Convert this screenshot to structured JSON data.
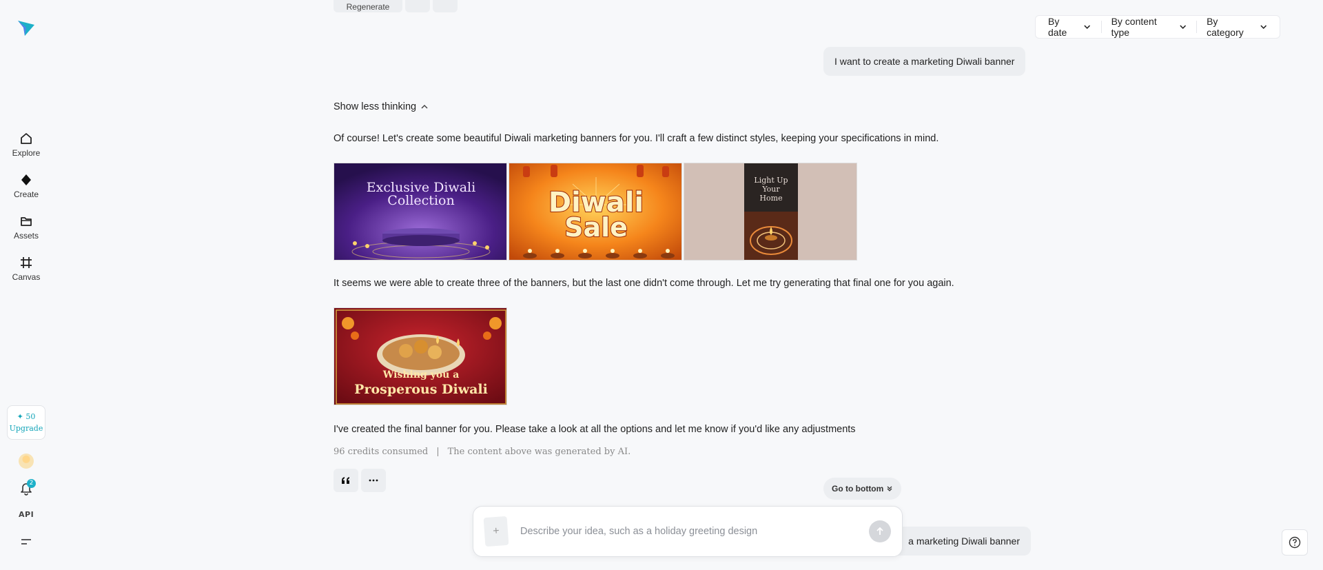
{
  "sidebar": {
    "logo_icon": "paper-plane-logo",
    "items": [
      {
        "label": "Explore",
        "icon": "home-icon"
      },
      {
        "label": "Create",
        "icon": "diamond-icon"
      },
      {
        "label": "Assets",
        "icon": "folder-icon"
      },
      {
        "label": "Canvas",
        "icon": "crop-icon"
      }
    ],
    "credits": "50",
    "upgrade_label": "Upgrade",
    "notification_count": "2",
    "api_label": "API"
  },
  "filters": {
    "by_date": "By date",
    "by_content_type": "By content type",
    "by_category": "By category"
  },
  "top_toolbar": {
    "regenerate_label": "Regenerate"
  },
  "chat": {
    "user_message_1": "I want to create a marketing Diwali banner",
    "thinking_toggle": "Show less thinking",
    "ai_intro": "Of course! Let's create some beautiful Diwali marketing banners for you. I'll craft a few distinct styles, keeping your specifications in mind.",
    "banners": [
      {
        "title_line1": "Exclusive Diwali",
        "title_line2": "Collection"
      },
      {
        "title_line1": "Diwali",
        "title_line2": "Sale"
      },
      {
        "title_line1": "Light Up",
        "title_line2": "Your",
        "title_line3": "Home"
      }
    ],
    "ai_followup": "It seems we were able to create three of the banners, but the last one didn't come through. Let me try generating that final one for you again.",
    "banner_final": {
      "title_line1": "Wishing you a",
      "title_line2": "Prosperous Diwali"
    },
    "ai_final": "I've created the final banner for you. Please take a look at all the options and let me know if you'd like any adjustments",
    "credits_consumed": "96 credits consumed",
    "separator": "|",
    "ai_disclaimer": "The content above was generated by AI.",
    "go_to_bottom": "Go to bottom",
    "user_message_2_partial": "a marketing Diwali banner"
  },
  "input": {
    "placeholder": "Describe your idea, such as a holiday greeting design",
    "attach_glyph": "+"
  },
  "colors": {
    "accent": "#1db0c8",
    "background": "#f7f8fa",
    "bubble": "#eceef1"
  }
}
